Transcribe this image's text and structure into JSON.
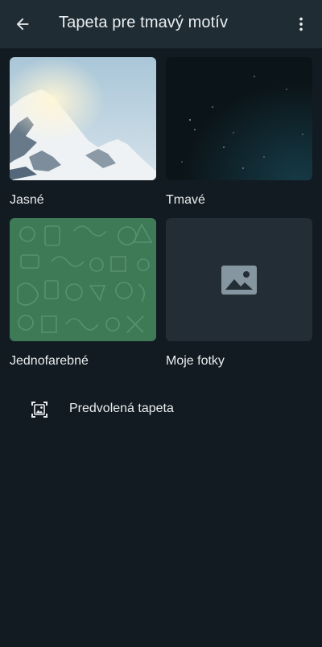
{
  "app_bar": {
    "title": "Tapeta pre tmavý motív",
    "back_icon": "arrow-back-icon",
    "menu_icon": "more-vertical-icon"
  },
  "categories": [
    {
      "label": "Jasné"
    },
    {
      "label": "Tmavé"
    },
    {
      "label": "Jednofarebné"
    },
    {
      "label": "Moje fotky"
    }
  ],
  "default_wallpaper": {
    "label": "Predvolená tapeta",
    "icon": "wallpaper-icon"
  },
  "colors": {
    "background": "#121b22",
    "app_bar": "#1f2c34",
    "text": "#e9edef",
    "solid_green": "#3f7a57",
    "photos_tile": "#222d35",
    "icon_gray": "#8696a0"
  }
}
